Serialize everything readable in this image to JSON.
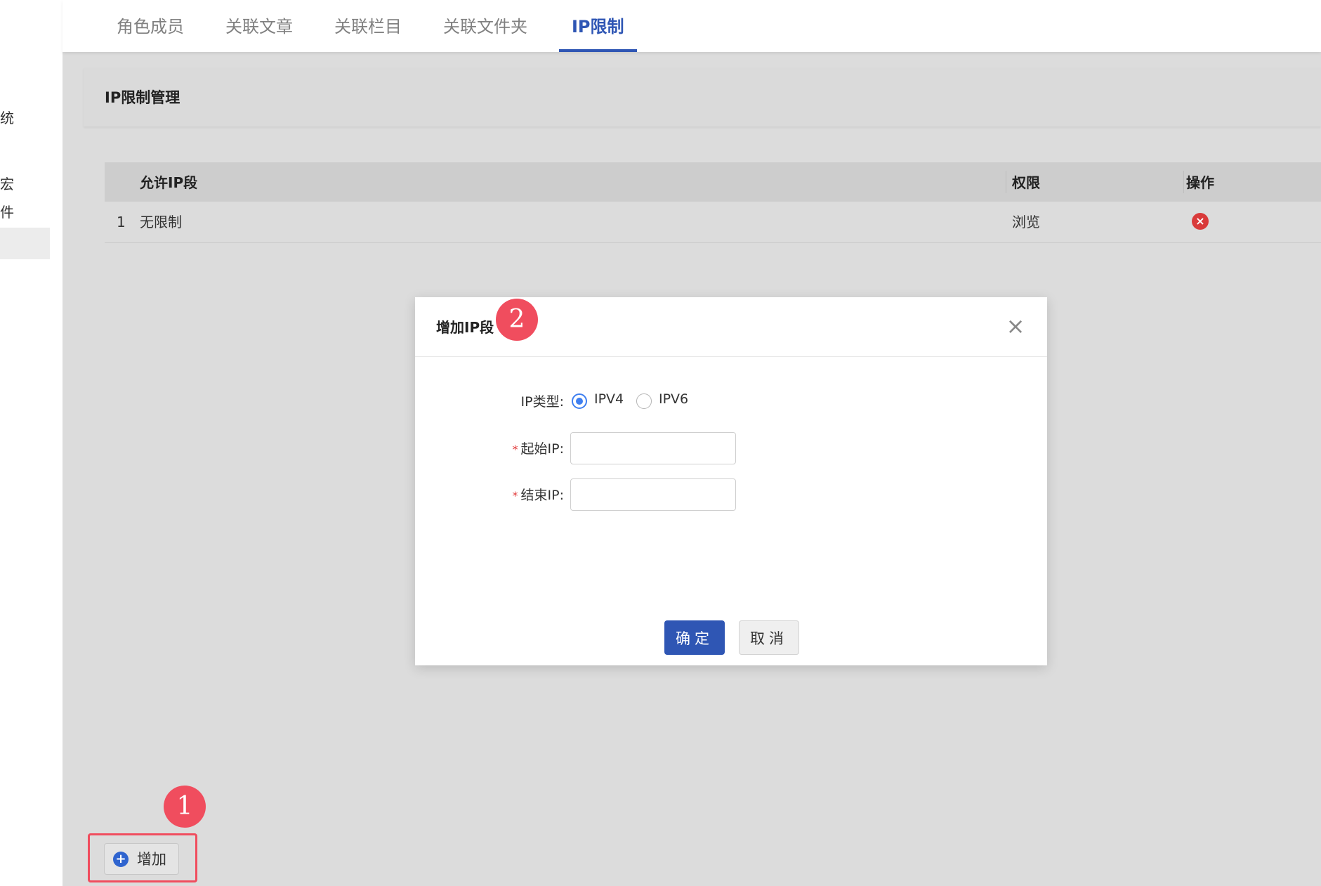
{
  "sidebar": {
    "fragments": [
      "统",
      "宏",
      "件"
    ]
  },
  "tabs": [
    {
      "label": "角色成员"
    },
    {
      "label": "关联文章"
    },
    {
      "label": "关联栏目"
    },
    {
      "label": "关联文件夹"
    },
    {
      "label": "IP限制",
      "active": true
    }
  ],
  "panel": {
    "title": "IP限制管理"
  },
  "table": {
    "columns": [
      "允许IP段",
      "权限",
      "操作"
    ],
    "rows": [
      {
        "index": "1",
        "range": "无限制",
        "permission": "浏览"
      }
    ]
  },
  "modal": {
    "title": "增加IP段",
    "close_glyph": "×",
    "ip_type_label": "IP类型:",
    "ip_types": [
      "IPV4",
      "IPV6"
    ],
    "selected_type": "IPV4",
    "required_mark": "*",
    "start_ip_label": "起始IP:",
    "start_ip_value": "",
    "end_ip_label": "结束IP:",
    "end_ip_value": "",
    "ok_label": "确定",
    "cancel_label": "取消"
  },
  "add_button": {
    "icon_glyph": "+",
    "label": "增加"
  },
  "delete_glyph": "×",
  "annotations": [
    {
      "number": "1"
    },
    {
      "number": "2"
    }
  ],
  "colors": {
    "accent": "#2f56b4",
    "badge": "#f04d5e",
    "danger": "#d93a3a",
    "radio": "#3f7ff0"
  }
}
